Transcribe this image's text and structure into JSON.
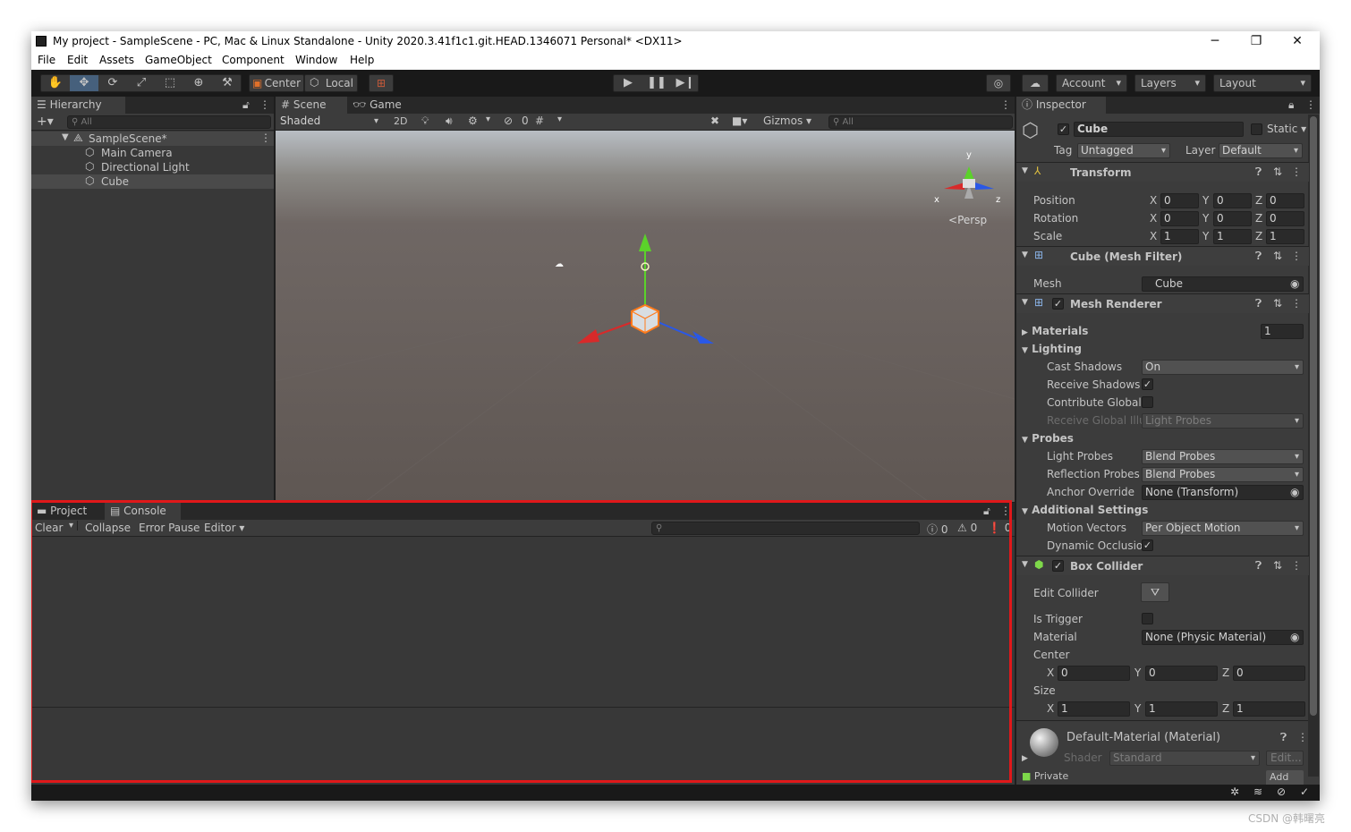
{
  "window": {
    "title": "My project - SampleScene - PC, Mac & Linux Standalone - Unity 2020.3.41f1c1.git.HEAD.1346071 Personal* <DX11>"
  },
  "menu": [
    "File",
    "Edit",
    "Assets",
    "GameObject",
    "Component",
    "Window",
    "Help"
  ],
  "toolbar": {
    "center": "Center",
    "local": "Local",
    "account": "Account",
    "layers": "Layers",
    "layout": "Layout"
  },
  "hierarchy": {
    "tab": "Hierarchy",
    "search": "All",
    "scene": "SampleScene*",
    "items": [
      "Main Camera",
      "Directional Light",
      "Cube"
    ]
  },
  "scene": {
    "tab_scene": "Scene",
    "tab_game": "Game",
    "shading": "Shaded",
    "mode2d": "2D",
    "hidden_count": "0",
    "gizmos": "Gizmos",
    "search": "All",
    "persp": "Persp",
    "axis_x": "x",
    "axis_y": "y",
    "axis_z": "z"
  },
  "console": {
    "tab_project": "Project",
    "tab_console": "Console",
    "clear": "Clear",
    "collapse": "Collapse",
    "error_pause": "Error Pause",
    "editor": "Editor",
    "log_count": "0",
    "warn_count": "0",
    "error_count": "0"
  },
  "inspector": {
    "tab": "Inspector",
    "name": "Cube",
    "static": "Static",
    "tag_label": "Tag",
    "tag": "Untagged",
    "layer_label": "Layer",
    "layer": "Default",
    "transform": {
      "title": "Transform",
      "position_label": "Position",
      "rotation_label": "Rotation",
      "scale_label": "Scale",
      "position": [
        "0",
        "0",
        "0"
      ],
      "rotation": [
        "0",
        "0",
        "0"
      ],
      "scale": [
        "1",
        "1",
        "1"
      ]
    },
    "axis": {
      "x": "X",
      "y": "Y",
      "z": "Z"
    },
    "mesh_filter": {
      "title": "Cube (Mesh Filter)",
      "mesh_label": "Mesh",
      "mesh": "Cube"
    },
    "mesh_renderer": {
      "title": "Mesh Renderer",
      "materials": "Materials",
      "materials_count": "1",
      "lighting": "Lighting",
      "cast_shadows_label": "Cast Shadows",
      "cast_shadows": "On",
      "receive_shadows": "Receive Shadows",
      "contribute_gi": "Contribute Global I",
      "receive_gi_label": "Receive Global Illu",
      "receive_gi": "Light Probes",
      "probes": "Probes",
      "light_probes_label": "Light Probes",
      "light_probes": "Blend Probes",
      "reflection_probes_label": "Reflection Probes",
      "reflection_probes": "Blend Probes",
      "anchor_override_label": "Anchor Override",
      "anchor_override": "None (Transform)",
      "additional": "Additional Settings",
      "motion_vectors_label": "Motion Vectors",
      "motion_vectors": "Per Object Motion",
      "dynamic_occlusion": "Dynamic Occlusio"
    },
    "box_collider": {
      "title": "Box Collider",
      "edit_collider": "Edit Collider",
      "is_trigger": "Is Trigger",
      "material_label": "Material",
      "material": "None (Physic Material)",
      "center_label": "Center",
      "center": [
        "0",
        "0",
        "0"
      ],
      "size_label": "Size",
      "size": [
        "1",
        "1",
        "1"
      ]
    },
    "material": {
      "title": "Default-Material (Material)",
      "shader_label": "Shader",
      "shader": "Standard",
      "edit": "Edit...",
      "private": "Private",
      "add": "Add"
    }
  },
  "watermark": "CSDN @韩曙亮",
  "colors": {
    "highlight_box": "#e0181a",
    "active_tool": "#46607c",
    "x_axis": "#d82a2a",
    "y_axis": "#5bd22a",
    "z_axis": "#2a58e6"
  }
}
